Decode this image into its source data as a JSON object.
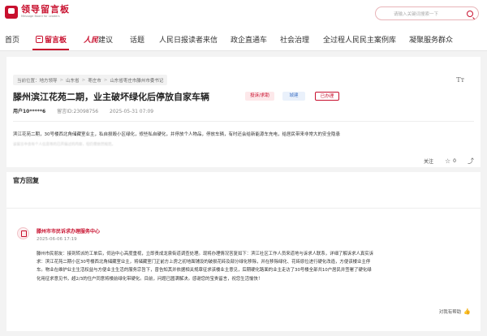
{
  "header": {
    "logo_title": "领导留言板",
    "logo_subtitle": "Message Board for Leaders",
    "search_placeholder": "请输入关键词搜索一下"
  },
  "nav": {
    "items": [
      "首页",
      "留言板",
      "建议",
      "话题",
      "人民日报读者来信",
      "政企直通车",
      "社会治理",
      "全过程人民民主案例库",
      "凝聚服务群众"
    ],
    "rmrb_brand": "人民"
  },
  "breadcrumb": {
    "prefix": "当前位置：",
    "items": [
      "地方领导",
      "山东省",
      "枣庄市",
      "山东省枣庄市滕州市委书记"
    ]
  },
  "message": {
    "title": "滕州滨江花苑二期，业主破坏绿化后停放自家车辆",
    "tag_type": "投诉/求助",
    "tag_field": "城建",
    "tag_status": "已办理",
    "author": "用户10*****6",
    "message_id": "留言ID:23098756",
    "datetime": "2025-05-31 07:09",
    "content": "滨江花苑二期，30号楼西北角储藏室业主，私自损毁小区绿化，修些私自硬化，并停放个人物品，停放车辆，有时还会给新能源车充电，给居民带来非常大的安全隐患",
    "disclaimer": "该留言中含有个人信息等的已开展过的内容，但仍需依然规范。",
    "follow_label": "关注",
    "favorite_count": "0",
    "font_toggle": "Tт"
  },
  "reply": {
    "section_title": "官方回复",
    "org_name": "滕州市市民诉求办理服务中心",
    "date": "2025-06-06 17:19",
    "lines": [
      "滕州市民朋友：接到转派的工单后，伺治中心高度重视，立即责成龙泉街道调查处理。现将办理情况答复如下：滨江社区工作人员来道地与诉求人联系，详细了解诉求人真实诉",
      "求：滨江花苑二期小区30号楼西北角储藏室业主，将储藏室门正前方上房之初地面铺设的破损花砖及部分绿化移除，并在移除绿化、花砖原位进行硬化改造，方便该楼业主停",
      "车。物业在维护业主生活权益与方便业主生活的服务宗旨下，曾告知其并依据相关规章征求该楼业主意见，后期硬化路面的业主走访了30号楼全部共10户居民并签署了硬化绿",
      "化用征求意见书，超2/3的住户同意将楼前绿化带硬化。目前，问题已圆满解决。感谢您的宝贵留言，祝您生活愉快！"
    ],
    "helpful_label": "对我有帮助"
  }
}
